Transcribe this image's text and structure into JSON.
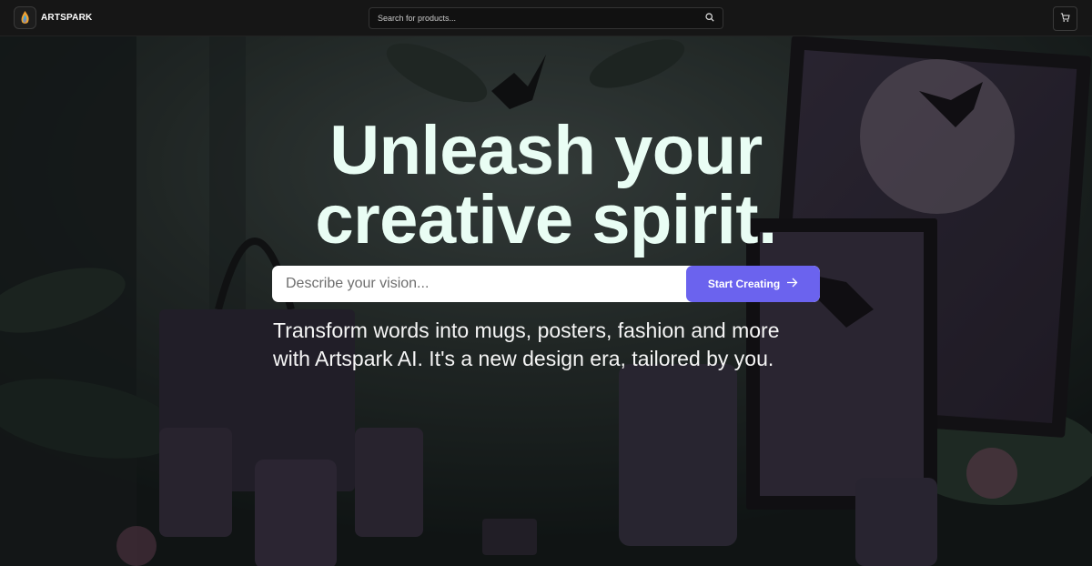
{
  "brand": {
    "name": "ARTSPARK"
  },
  "nav": {
    "search_placeholder": "Search for products...",
    "search_icon": "search-icon",
    "cart_icon": "cart-icon"
  },
  "hero": {
    "headline_line1": "Unleash your",
    "headline_line2": "creative spirit.",
    "prompt_placeholder": "Describe your vision...",
    "cta_label": "Start Creating",
    "cta_icon": "arrow-right-icon",
    "subtext_line1": "Transform words into mugs, posters, fashion and more",
    "subtext_line2": "with Artspark AI. It's a new design era, tailored by you."
  },
  "colors": {
    "accent": "#6b63ee",
    "headline": "#e9fdf4",
    "nav_bg": "#161616"
  }
}
